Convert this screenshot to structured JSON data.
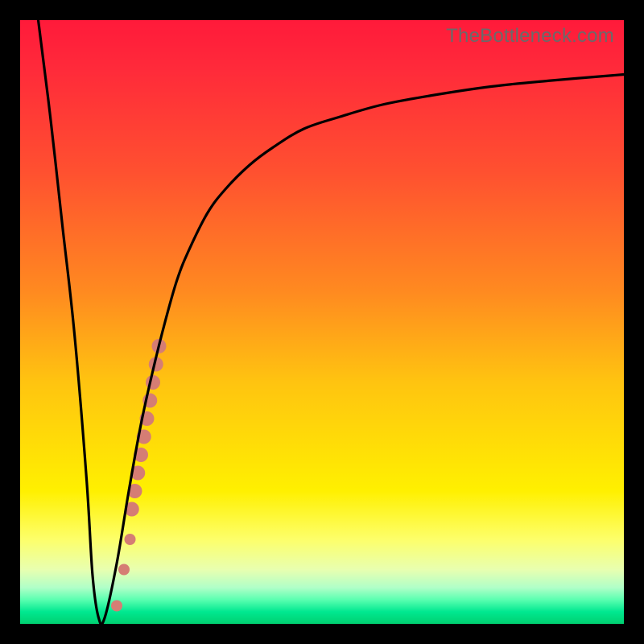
{
  "watermark": "TheBottleneck.com",
  "chart_data": {
    "type": "line",
    "title": "",
    "xlabel": "",
    "ylabel": "",
    "xlim": [
      0,
      100
    ],
    "ylim": [
      0,
      100
    ],
    "series": [
      {
        "name": "curve",
        "x": [
          3,
          5,
          7,
          9,
          11,
          12,
          13,
          14,
          16,
          18,
          20,
          22,
          24,
          26,
          28,
          31,
          34,
          38,
          42,
          47,
          53,
          60,
          68,
          78,
          88,
          100
        ],
        "y": [
          100,
          84,
          66,
          48,
          24,
          8,
          1,
          1,
          10,
          22,
          33,
          42,
          50,
          57,
          62,
          68,
          72,
          76,
          79,
          82,
          84,
          86,
          87.5,
          89,
          90,
          91
        ]
      }
    ],
    "markers": {
      "name": "highlight-band",
      "color": "#d57d74",
      "points": [
        {
          "x": 16.0,
          "y": 3,
          "r": 7
        },
        {
          "x": 17.2,
          "y": 9,
          "r": 7
        },
        {
          "x": 18.2,
          "y": 14,
          "r": 7
        },
        {
          "x": 18.5,
          "y": 19,
          "r": 9
        },
        {
          "x": 19.0,
          "y": 22,
          "r": 9
        },
        {
          "x": 19.5,
          "y": 25,
          "r": 9
        },
        {
          "x": 20.0,
          "y": 28,
          "r": 9
        },
        {
          "x": 20.5,
          "y": 31,
          "r": 9
        },
        {
          "x": 21.0,
          "y": 34,
          "r": 9
        },
        {
          "x": 21.5,
          "y": 37,
          "r": 9
        },
        {
          "x": 22.0,
          "y": 40,
          "r": 9
        },
        {
          "x": 22.5,
          "y": 43,
          "r": 9
        },
        {
          "x": 23.0,
          "y": 46,
          "r": 9
        }
      ]
    }
  }
}
